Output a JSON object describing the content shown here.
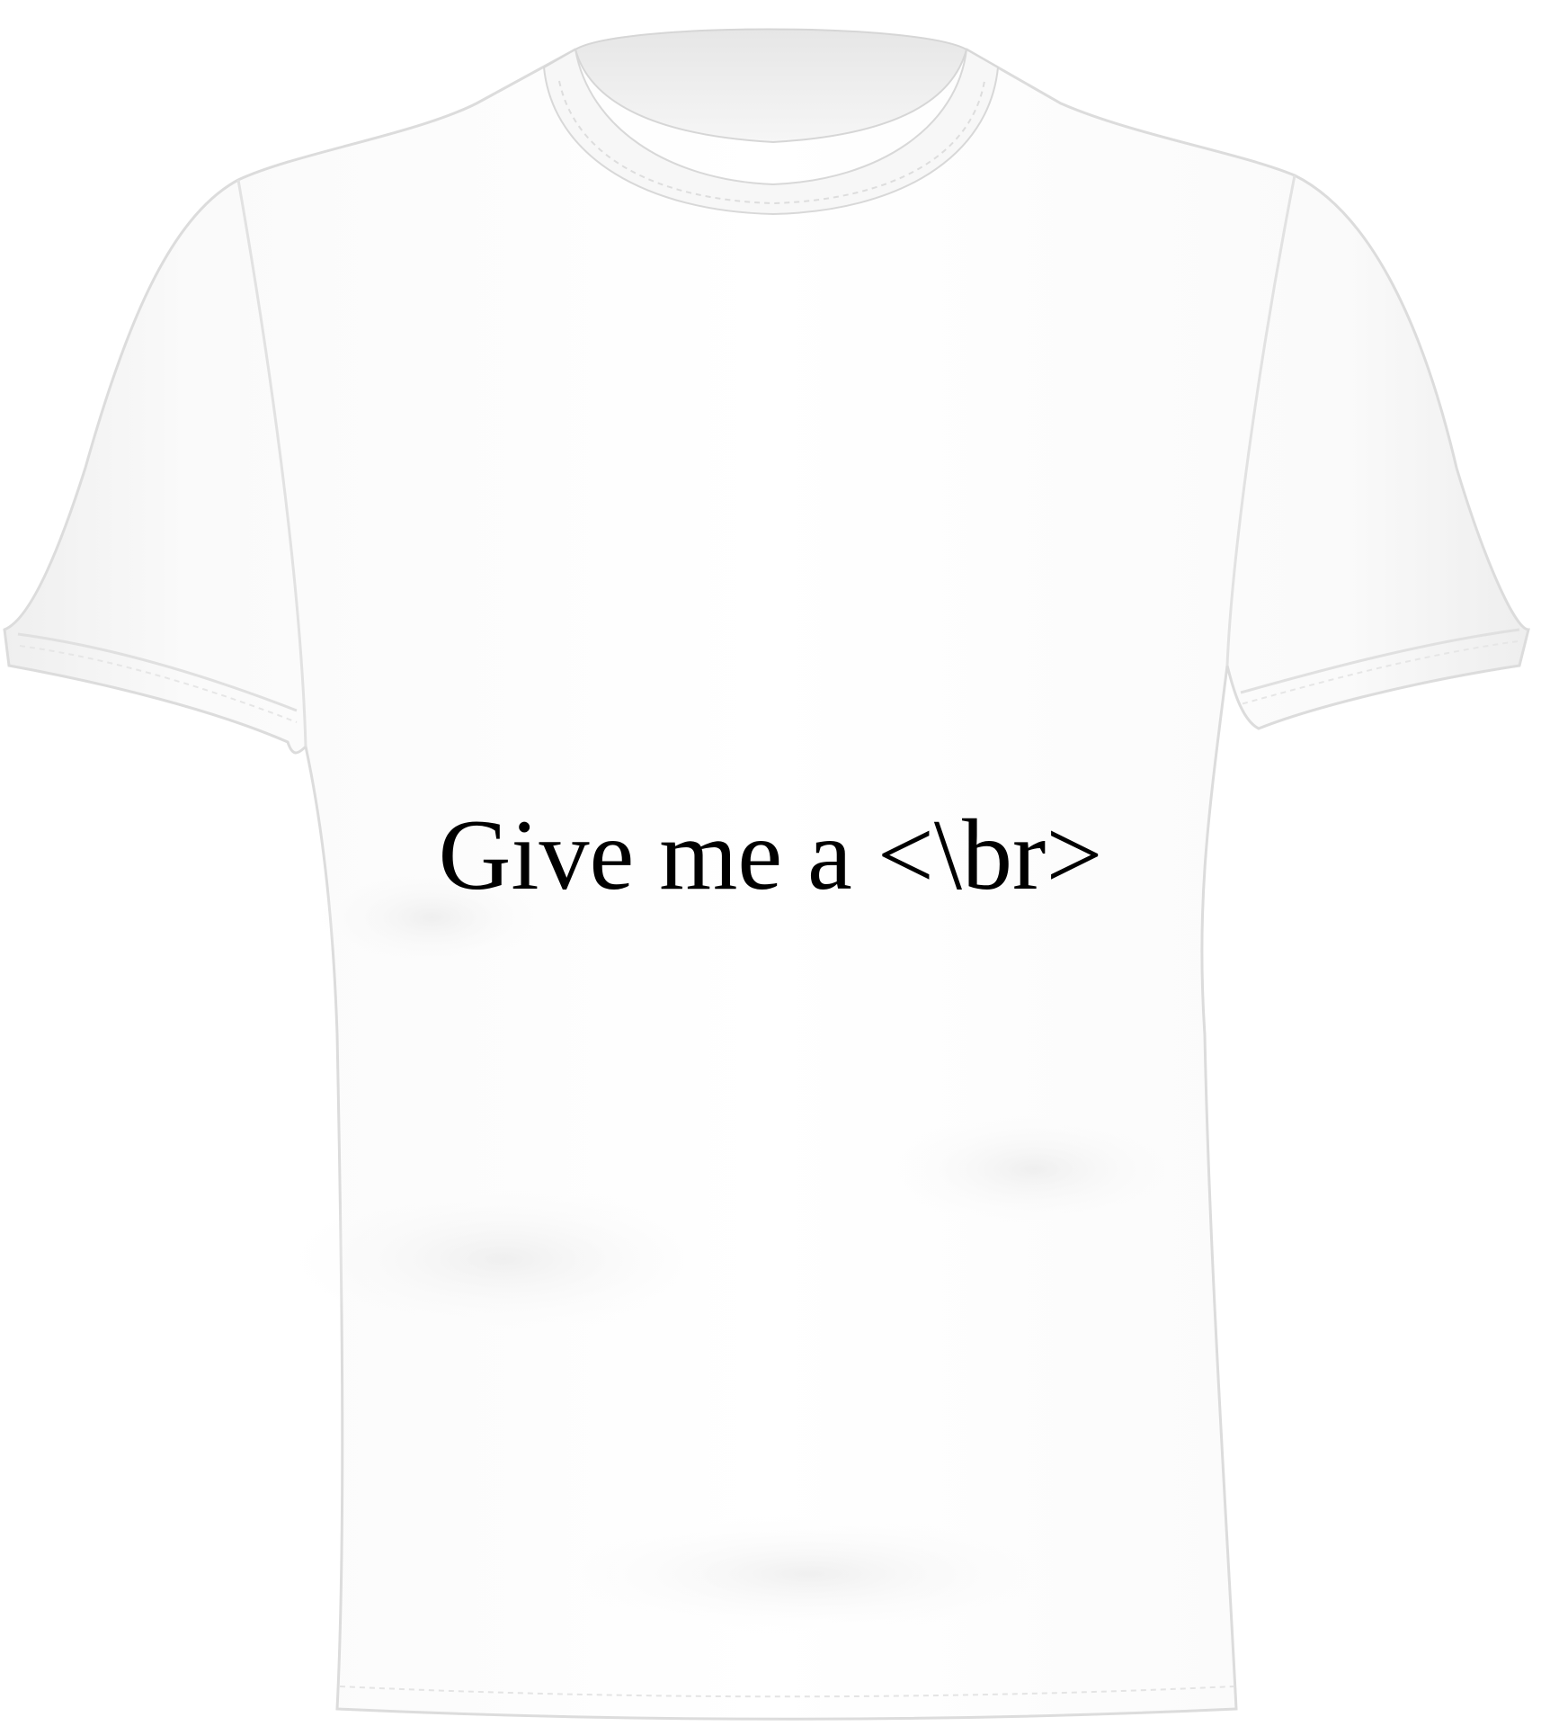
{
  "product": {
    "garment": "t-shirt",
    "garment_color": "#ffffff",
    "print_text": "Give me a <\\br>",
    "print_color": "#000000"
  },
  "icons": {
    "shirt": "tshirt-icon"
  }
}
